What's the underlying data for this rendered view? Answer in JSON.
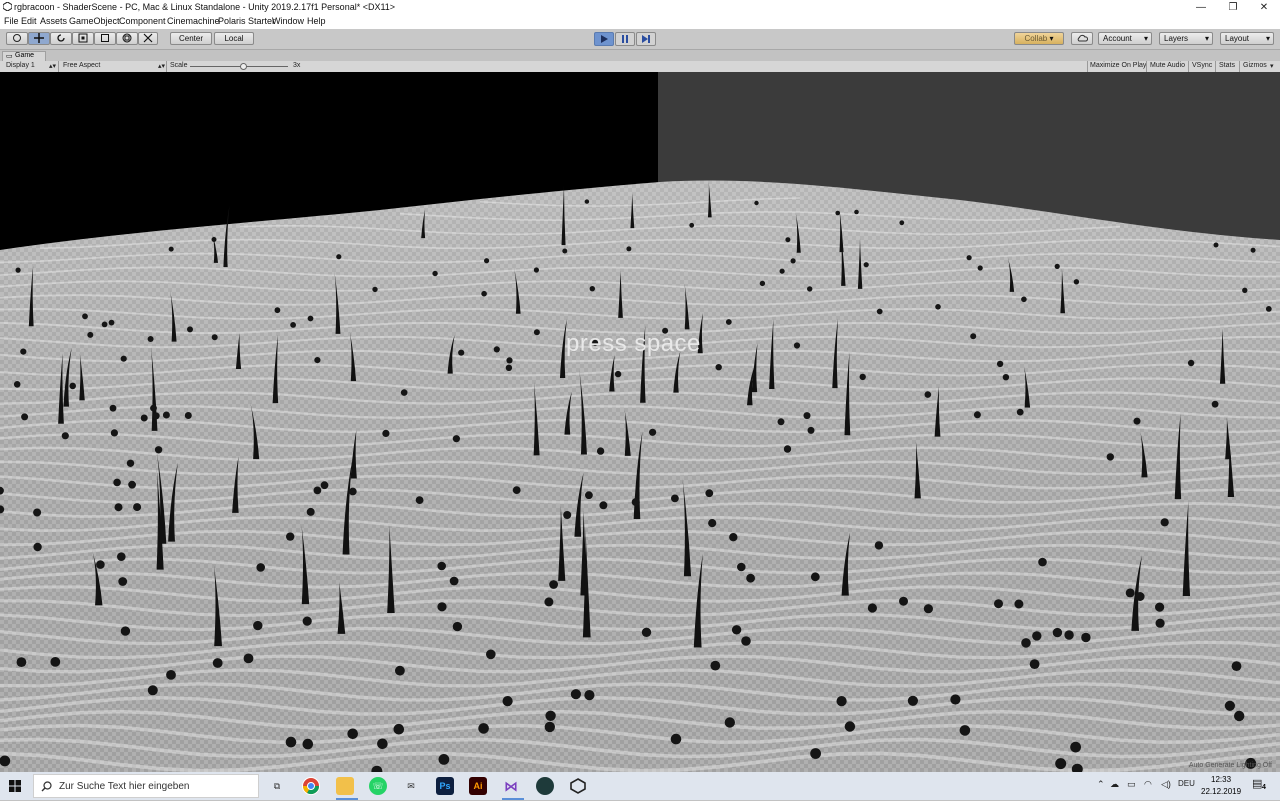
{
  "window": {
    "title": "rgbracoon - ShaderScene - PC, Mac & Linux Standalone - Unity 2019.2.17f1 Personal* <DX11>",
    "controls": [
      "—",
      "❐",
      "✕"
    ]
  },
  "menu": [
    "File",
    "Edit",
    "Assets",
    "GameObject",
    "Component",
    "Cinemachine",
    "Polaris Starter",
    "Window",
    "Help"
  ],
  "toolbar": {
    "tools": [
      "hand-tool",
      "move-tool",
      "rotate-tool",
      "scale-tool",
      "rect-tool",
      "transform-tool",
      "custom-tool"
    ],
    "pivot_label": "Center",
    "space_label": "Local",
    "collab_label": "Collab",
    "account_label": "Account",
    "layers_label": "Layers",
    "layout_label": "Layout"
  },
  "game_panel": {
    "tab_label": "Game",
    "display": "Display 1",
    "aspect": "Free Aspect",
    "scale_label": "Scale",
    "scale_value": "3x",
    "options": [
      "Maximize On Play",
      "Mute Audio",
      "VSync",
      "Stats",
      "Gizmos"
    ]
  },
  "viewport": {
    "overlay_text": "press space",
    "status_text": "Auto Generate Lighting Off"
  },
  "taskbar": {
    "search_placeholder": "Zur Suche Text hier eingeben",
    "language": "DEU",
    "time": "12:33",
    "date": "22.12.2019",
    "notification_count": "4"
  },
  "colors": {
    "play_blue": "#6e93cf",
    "terrain": "#b8b8b8"
  }
}
